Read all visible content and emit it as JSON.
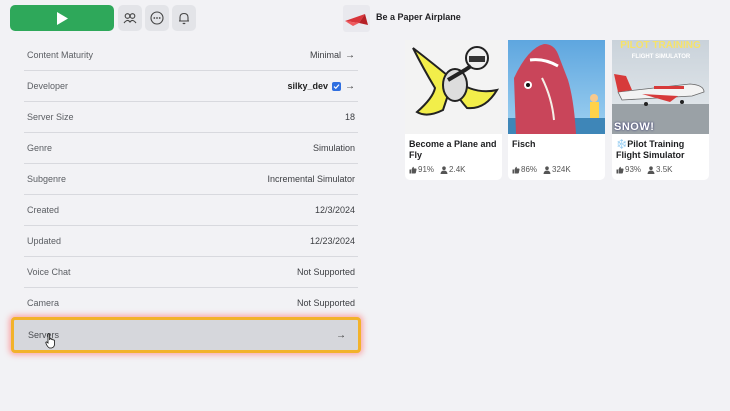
{
  "topbar": {
    "play_icon": "play-icon",
    "party_icon": "party-icon",
    "more_icon": "more-icon",
    "notification_icon": "bell-icon",
    "game_title": "Be a Paper Airplane"
  },
  "details": [
    {
      "label": "Content Maturity",
      "value": "Minimal",
      "arrow": "→"
    },
    {
      "label": "Developer",
      "value": "silky_dev",
      "arrow": "→"
    },
    {
      "label": "Server Size",
      "value": "18"
    },
    {
      "label": "Genre",
      "value": "Simulation"
    },
    {
      "label": "Subgenre",
      "value": "Incremental Simulator"
    },
    {
      "label": "Created",
      "value": "12/3/2024"
    },
    {
      "label": "Updated",
      "value": "12/23/2024"
    },
    {
      "label": "Voice Chat",
      "value": "Not Supported"
    },
    {
      "label": "Camera",
      "value": "Not Supported"
    }
  ],
  "servers": {
    "label": "Servers",
    "arrow": "→"
  },
  "cards": [
    {
      "name": "Become a Plane and Fly",
      "rating": "91%",
      "players": "2.4K"
    },
    {
      "name": "Fisch",
      "rating": "86%",
      "players": "324K"
    },
    {
      "name": "❄️Pilot Training Flight Simulator",
      "rating": "93%",
      "players": "3.5K",
      "thumb_title": "PILOT TRAINING",
      "thumb_subtitle": "FLIGHT SIMULATOR",
      "thumb_badge": "SNOW!"
    }
  ],
  "colors": {
    "play": "#2ea85a",
    "highlight": "#f2b22a",
    "verified": "#2f6fe0"
  }
}
